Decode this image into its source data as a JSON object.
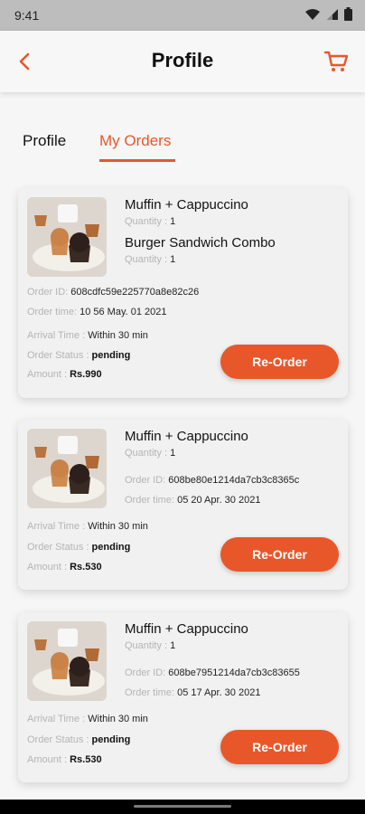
{
  "status_bar": {
    "time": "9:41"
  },
  "header": {
    "title": "Profile"
  },
  "tabs": [
    {
      "label": "Profile",
      "active": false
    },
    {
      "label": "My Orders",
      "active": true
    }
  ],
  "labels": {
    "quantity": "Quantity : ",
    "order_id": "Order ID:",
    "order_time": "Order time:",
    "arrival_time": "Arrival Time :",
    "order_status": "Order Status :",
    "amount": "Amount :",
    "reorder_button": "Re-Order"
  },
  "orders": [
    {
      "items": [
        {
          "name": "Muffin + Cappuccino",
          "quantity": "1"
        },
        {
          "name": "Burger Sandwich Combo",
          "quantity": "1"
        }
      ],
      "order_id": "608cdfc59e225770a8e82c26",
      "order_time": "10 56 May. 01 2021",
      "arrival_time": "Within 30 min",
      "status": "pending",
      "amount": "Rs.990"
    },
    {
      "items": [
        {
          "name": "Muffin + Cappuccino",
          "quantity": "1"
        }
      ],
      "order_id": "608be80e1214da7cb3c8365c",
      "order_time": "05 20 Apr. 30 2021",
      "arrival_time": "Within 30 min",
      "status": "pending",
      "amount": "Rs.530"
    },
    {
      "items": [
        {
          "name": "Muffin + Cappuccino",
          "quantity": "1"
        }
      ],
      "order_id": "608be7951214da7cb3c83655",
      "order_time": "05 17 Apr. 30 2021",
      "arrival_time": "Within 30 min",
      "status": "pending",
      "amount": "Rs.530"
    }
  ],
  "colors": {
    "accent": "#e8572a",
    "status_bar": "#bdbdbd",
    "card_bg": "#f1f1f1"
  },
  "icons": {
    "back": "chevron-left-icon",
    "cart": "cart-icon",
    "wifi": "wifi-icon",
    "signal": "signal-icon",
    "battery": "battery-icon"
  }
}
